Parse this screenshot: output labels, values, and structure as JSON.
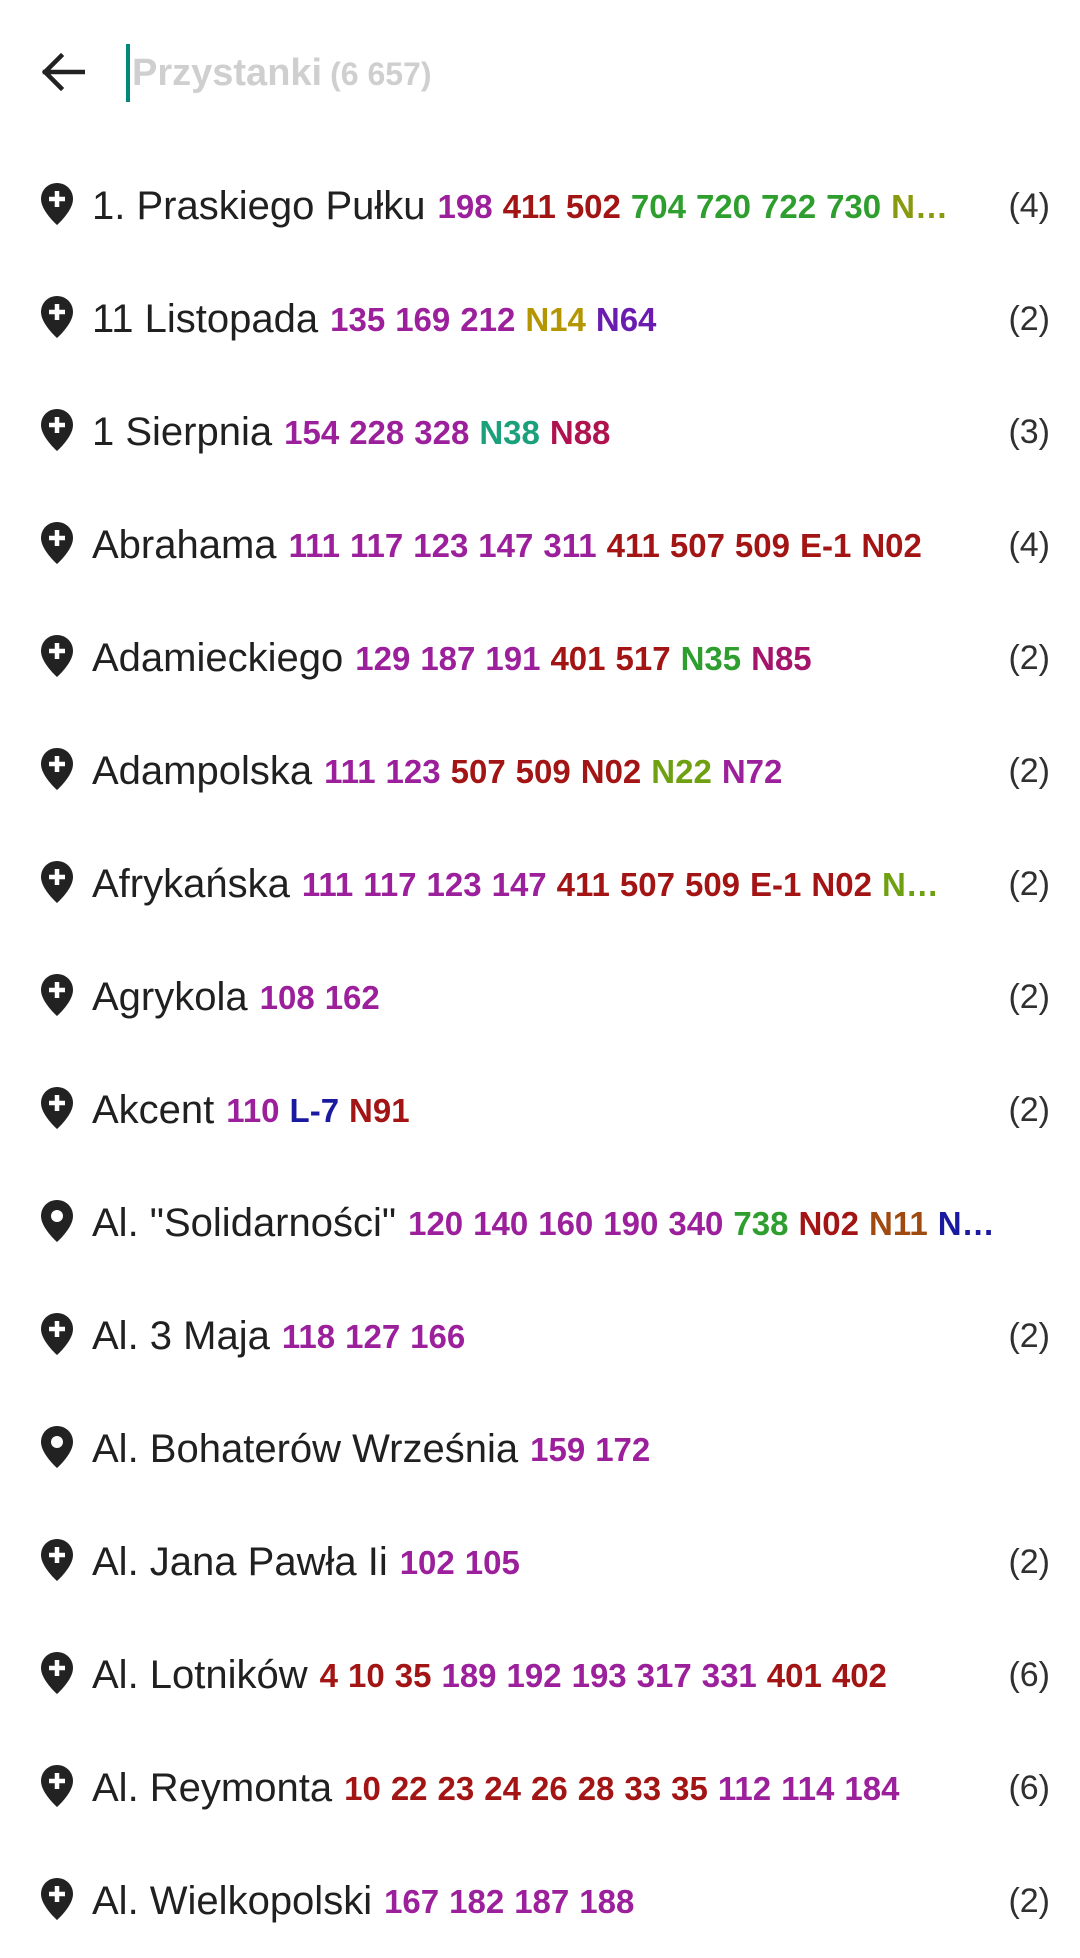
{
  "search": {
    "placeholder": "Przystanki",
    "count_label": "(6 657)"
  },
  "icons": {
    "back": "arrow-left-icon",
    "pin_plus": "map-pin-plus-icon",
    "pin": "map-pin-icon"
  },
  "colors": {
    "accent": "#00897b"
  },
  "stops": [
    {
      "name": "1. Praskiego Pułku",
      "count": "(4)",
      "pin": "plus",
      "lines": [
        {
          "t": "198",
          "c": "#9c1f9c"
        },
        {
          "t": "411",
          "c": "#a31515"
        },
        {
          "t": "502",
          "c": "#a31515"
        },
        {
          "t": "704",
          "c": "#2e9e2e"
        },
        {
          "t": "720",
          "c": "#2e9e2e"
        },
        {
          "t": "722",
          "c": "#2e9e2e"
        },
        {
          "t": "730",
          "c": "#2e9e2e"
        },
        {
          "t": "N…",
          "c": "#8a9a10"
        }
      ]
    },
    {
      "name": "11 Listopada",
      "count": "(2)",
      "pin": "plus",
      "lines": [
        {
          "t": "135",
          "c": "#9c1f9c"
        },
        {
          "t": "169",
          "c": "#9c1f9c"
        },
        {
          "t": "212",
          "c": "#9c1f9c"
        },
        {
          "t": "N14",
          "c": "#b39600"
        },
        {
          "t": "N64",
          "c": "#6a1bb0"
        }
      ]
    },
    {
      "name": "1 Sierpnia",
      "count": "(3)",
      "pin": "plus",
      "lines": [
        {
          "t": "154",
          "c": "#9c1f9c"
        },
        {
          "t": "228",
          "c": "#9c1f9c"
        },
        {
          "t": "328",
          "c": "#9c1f9c"
        },
        {
          "t": "N38",
          "c": "#1aa07a"
        },
        {
          "t": "N88",
          "c": "#b0124f"
        }
      ]
    },
    {
      "name": "Abrahama",
      "count": "(4)",
      "pin": "plus",
      "lines": [
        {
          "t": "111",
          "c": "#9c1f9c"
        },
        {
          "t": "117",
          "c": "#9c1f9c"
        },
        {
          "t": "123",
          "c": "#9c1f9c"
        },
        {
          "t": "147",
          "c": "#9c1f9c"
        },
        {
          "t": "311",
          "c": "#9c1f9c"
        },
        {
          "t": "411",
          "c": "#a31515"
        },
        {
          "t": "507",
          "c": "#a31515"
        },
        {
          "t": "509",
          "c": "#a31515"
        },
        {
          "t": "E-1",
          "c": "#a31515"
        },
        {
          "t": "N02",
          "c": "#a31515"
        }
      ]
    },
    {
      "name": "Adamieckiego",
      "count": "(2)",
      "pin": "plus",
      "lines": [
        {
          "t": "129",
          "c": "#9c1f9c"
        },
        {
          "t": "187",
          "c": "#9c1f9c"
        },
        {
          "t": "191",
          "c": "#9c1f9c"
        },
        {
          "t": "401",
          "c": "#a31515"
        },
        {
          "t": "517",
          "c": "#a31515"
        },
        {
          "t": "N35",
          "c": "#2e9e2e"
        },
        {
          "t": "N85",
          "c": "#a3146a"
        }
      ]
    },
    {
      "name": "Adampolska",
      "count": "(2)",
      "pin": "plus",
      "lines": [
        {
          "t": "111",
          "c": "#9c1f9c"
        },
        {
          "t": "123",
          "c": "#9c1f9c"
        },
        {
          "t": "507",
          "c": "#a31515"
        },
        {
          "t": "509",
          "c": "#a31515"
        },
        {
          "t": "N02",
          "c": "#a31515"
        },
        {
          "t": "N22",
          "c": "#6fa012"
        },
        {
          "t": "N72",
          "c": "#9c1f9c"
        }
      ]
    },
    {
      "name": "Afrykańska",
      "count": "(2)",
      "pin": "plus",
      "lines": [
        {
          "t": "111",
          "c": "#9c1f9c"
        },
        {
          "t": "117",
          "c": "#9c1f9c"
        },
        {
          "t": "123",
          "c": "#9c1f9c"
        },
        {
          "t": "147",
          "c": "#9c1f9c"
        },
        {
          "t": "411",
          "c": "#a31515"
        },
        {
          "t": "507",
          "c": "#a31515"
        },
        {
          "t": "509",
          "c": "#a31515"
        },
        {
          "t": "E-1",
          "c": "#a31515"
        },
        {
          "t": "N02",
          "c": "#a31515"
        },
        {
          "t": "N…",
          "c": "#6fa012"
        }
      ]
    },
    {
      "name": "Agrykola",
      "count": "(2)",
      "pin": "plus",
      "lines": [
        {
          "t": "108",
          "c": "#9c1f9c"
        },
        {
          "t": "162",
          "c": "#9c1f9c"
        }
      ]
    },
    {
      "name": "Akcent",
      "count": "(2)",
      "pin": "plus",
      "lines": [
        {
          "t": "110",
          "c": "#9c1f9c"
        },
        {
          "t": "L-7",
          "c": "#1a1aa0"
        },
        {
          "t": "N91",
          "c": "#a31515"
        }
      ]
    },
    {
      "name": "Al. \"Solidarności\"",
      "count": "",
      "pin": "plain",
      "lines": [
        {
          "t": "120",
          "c": "#9c1f9c"
        },
        {
          "t": "140",
          "c": "#9c1f9c"
        },
        {
          "t": "160",
          "c": "#9c1f9c"
        },
        {
          "t": "190",
          "c": "#9c1f9c"
        },
        {
          "t": "340",
          "c": "#9c1f9c"
        },
        {
          "t": "738",
          "c": "#2e9e2e"
        },
        {
          "t": "N02",
          "c": "#a31515"
        },
        {
          "t": "N11",
          "c": "#a04a10"
        },
        {
          "t": "N…",
          "c": "#1a1aa0"
        }
      ]
    },
    {
      "name": "Al. 3 Maja",
      "count": "(2)",
      "pin": "plus",
      "lines": [
        {
          "t": "118",
          "c": "#9c1f9c"
        },
        {
          "t": "127",
          "c": "#9c1f9c"
        },
        {
          "t": "166",
          "c": "#9c1f9c"
        }
      ]
    },
    {
      "name": "Al. Bohaterów Września",
      "count": "",
      "pin": "plain",
      "lines": [
        {
          "t": "159",
          "c": "#9c1f9c"
        },
        {
          "t": "172",
          "c": "#9c1f9c"
        }
      ]
    },
    {
      "name": "Al. Jana Pawła Ii",
      "count": "(2)",
      "pin": "plus",
      "lines": [
        {
          "t": "102",
          "c": "#9c1f9c"
        },
        {
          "t": "105",
          "c": "#9c1f9c"
        }
      ]
    },
    {
      "name": "Al. Lotników",
      "count": "(6)",
      "pin": "plus",
      "lines": [
        {
          "t": "4",
          "c": "#a31515"
        },
        {
          "t": "10",
          "c": "#a31515"
        },
        {
          "t": "35",
          "c": "#a31515"
        },
        {
          "t": "189",
          "c": "#9c1f9c"
        },
        {
          "t": "192",
          "c": "#9c1f9c"
        },
        {
          "t": "193",
          "c": "#9c1f9c"
        },
        {
          "t": "317",
          "c": "#9c1f9c"
        },
        {
          "t": "331",
          "c": "#9c1f9c"
        },
        {
          "t": "401",
          "c": "#a31515"
        },
        {
          "t": "402",
          "c": "#a31515"
        }
      ]
    },
    {
      "name": "Al. Reymonta",
      "count": "(6)",
      "pin": "plus",
      "lines": [
        {
          "t": "10",
          "c": "#a31515"
        },
        {
          "t": "22",
          "c": "#a31515"
        },
        {
          "t": "23",
          "c": "#a31515"
        },
        {
          "t": "24",
          "c": "#a31515"
        },
        {
          "t": "26",
          "c": "#a31515"
        },
        {
          "t": "28",
          "c": "#a31515"
        },
        {
          "t": "33",
          "c": "#a31515"
        },
        {
          "t": "35",
          "c": "#a31515"
        },
        {
          "t": "112",
          "c": "#9c1f9c"
        },
        {
          "t": "114",
          "c": "#9c1f9c"
        },
        {
          "t": "184",
          "c": "#9c1f9c"
        }
      ]
    },
    {
      "name": "Al. Wielkopolski",
      "count": "(2)",
      "pin": "plus",
      "lines": [
        {
          "t": "167",
          "c": "#9c1f9c"
        },
        {
          "t": "182",
          "c": "#9c1f9c"
        },
        {
          "t": "187",
          "c": "#9c1f9c"
        },
        {
          "t": "188",
          "c": "#9c1f9c"
        }
      ]
    }
  ]
}
